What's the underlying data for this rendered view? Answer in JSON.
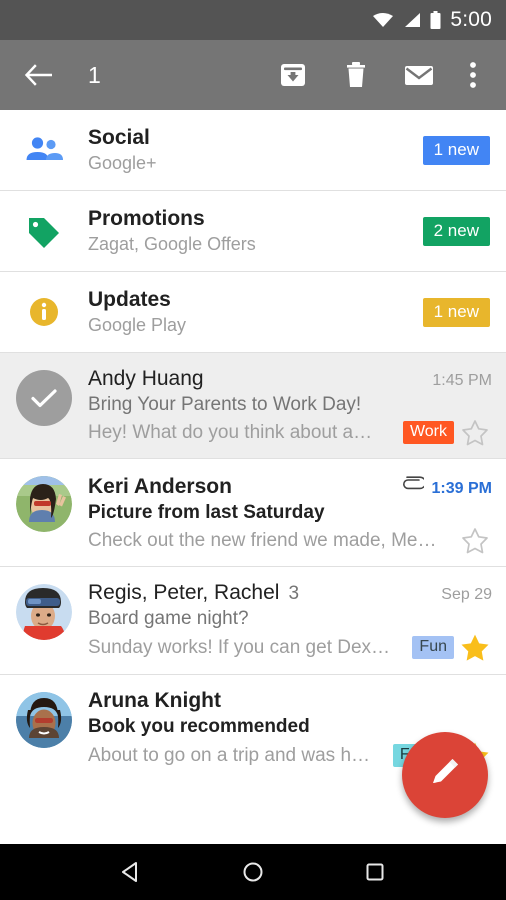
{
  "status_bar": {
    "time": "5:00",
    "wifi_icon": "wifi-icon",
    "signal_icon": "signal-icon",
    "battery_icon": "battery-icon"
  },
  "action_bar": {
    "back_icon": "back-arrow-icon",
    "selection_count": "1",
    "archive_icon": "archive-icon",
    "delete_icon": "trash-icon",
    "mail_icon": "mark-unread-envelope-icon",
    "overflow_icon": "overflow-menu-icon"
  },
  "label_rows": [
    {
      "icon": "people-icon",
      "icon_color": "#4285F4",
      "title": "Social",
      "subtitle": "Google+",
      "badge": "1 new",
      "badge_color": "#4285F4"
    },
    {
      "icon": "tag-icon",
      "icon_color": "#12A363",
      "title": "Promotions",
      "subtitle": "Zagat, Google Offers",
      "badge": "2 new",
      "badge_color": "#12A363"
    },
    {
      "icon": "info-icon",
      "icon_color": "#E8B62C",
      "title": "Updates",
      "subtitle": "Google Play",
      "badge": "1 new",
      "badge_color": "#E8B62C"
    }
  ],
  "emails": [
    {
      "sender": "Andy Huang",
      "count": "",
      "time": "1:45 PM",
      "time_blue": false,
      "subject": "Bring Your Parents to Work Day!",
      "snippet": "Hey! What do you think about a…",
      "label": "Work",
      "label_bg": "#FF5722",
      "label_fg": "#ffffff",
      "starred": false,
      "unread": false,
      "selected": true,
      "attachment": false,
      "avatar": "check-avatar"
    },
    {
      "sender": "Keri Anderson",
      "count": "",
      "time": "1:39 PM",
      "time_blue": true,
      "subject": "Picture from last Saturday",
      "snippet": "Check out the new friend we made, Me…",
      "label": "",
      "label_bg": "",
      "label_fg": "",
      "starred": false,
      "unread": true,
      "selected": false,
      "attachment": true,
      "avatar": "photo-avatar-keri"
    },
    {
      "sender": "Regis, Peter, Rachel",
      "count": "3",
      "time": "Sep 29",
      "time_blue": false,
      "subject": "Board game night?",
      "snippet": "Sunday works! If you can get Dex…",
      "label": "Fun",
      "label_bg": "#A4C2F4",
      "label_fg": "#37474f",
      "starred": true,
      "unread": false,
      "selected": false,
      "attachment": false,
      "avatar": "photo-avatar-regis"
    },
    {
      "sender": "Aruna Knight",
      "count": "",
      "time": "",
      "time_blue": true,
      "subject": "Book you recommended",
      "snippet": "About to go on a trip and was h…",
      "label": "Family",
      "label_bg": "#76D7E0",
      "label_fg": "#1a3c40",
      "starred": true,
      "unread": true,
      "selected": false,
      "attachment": false,
      "avatar": "photo-avatar-aruna"
    }
  ],
  "fab": {
    "icon": "compose-pencil-icon",
    "color": "#db4437"
  },
  "nav_bar": {
    "back_icon": "nav-back-triangle-icon",
    "home_icon": "nav-home-circle-icon",
    "recents_icon": "nav-recents-square-icon"
  }
}
